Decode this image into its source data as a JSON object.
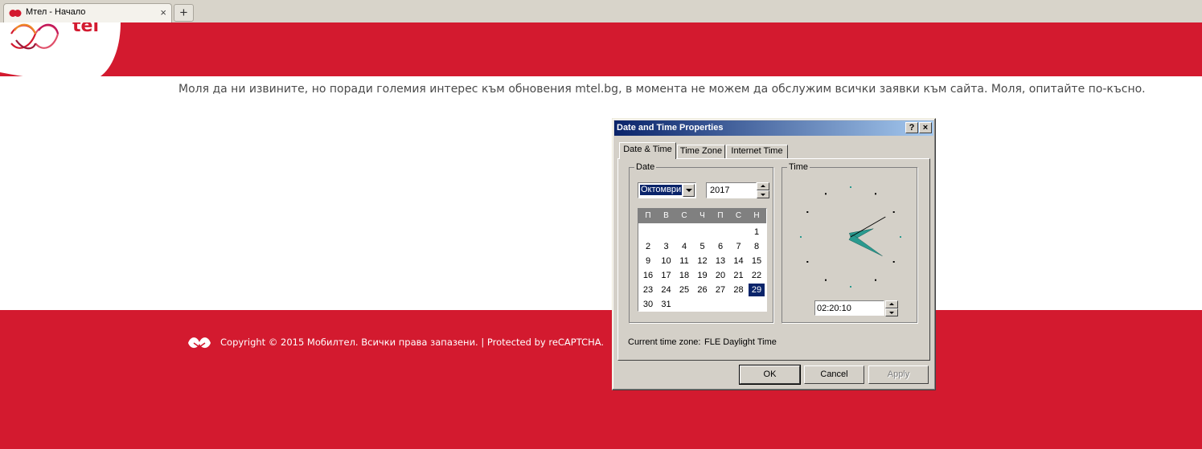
{
  "browser": {
    "tab_title": "Мтел - Начало",
    "tab_close": "×",
    "new_tab": "+"
  },
  "header": {
    "logo_text": "tel"
  },
  "notice": "Моля да ни извините, но поради големия интерес към обновения mtel.bg, в момента не можем да обслужим всички заявки към сайта. Моля, опитайте по-късно.",
  "footer": {
    "copyright": "Copyright © 2015 Мобилтел. Всички права запазени. | Protected by reCAPTCHA."
  },
  "dialog": {
    "title": "Date and Time Properties",
    "help": "?",
    "close": "×",
    "tabs": [
      "Date & Time",
      "Time Zone",
      "Internet Time"
    ],
    "date_group": "Date",
    "time_group": "Time",
    "month": "Октомври",
    "year": "2017",
    "weekdays": [
      "П",
      "В",
      "С",
      "Ч",
      "П",
      "С",
      "Н"
    ],
    "calendar_weeks": [
      [
        "",
        "",
        "",
        "",
        "",
        "",
        "1"
      ],
      [
        "2",
        "3",
        "4",
        "5",
        "6",
        "7",
        "8"
      ],
      [
        "9",
        "10",
        "11",
        "12",
        "13",
        "14",
        "15"
      ],
      [
        "16",
        "17",
        "18",
        "19",
        "20",
        "21",
        "22"
      ],
      [
        "23",
        "24",
        "25",
        "26",
        "27",
        "28",
        "29"
      ],
      [
        "30",
        "31",
        "",
        "",
        "",
        "",
        ""
      ]
    ],
    "selected_day": "29",
    "time": "02:20:10",
    "timezone_label": "Current time zone:",
    "timezone_value": "FLE Daylight Time",
    "buttons": {
      "ok": "OK",
      "cancel": "Cancel",
      "apply": "Apply"
    }
  },
  "colors": {
    "brand_red": "#d31a2f",
    "dialog_face": "#d4d0c8",
    "title_bar": "#0a246a",
    "clock_hand": "#2a9a8f"
  }
}
